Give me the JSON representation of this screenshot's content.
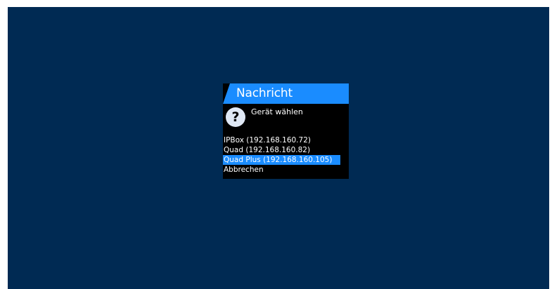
{
  "dialog": {
    "title": "Nachricht",
    "icon": "question-mark-icon",
    "message": "Gerät wählen",
    "options": [
      {
        "label": "IPBox (192.168.160.72)",
        "selected": false
      },
      {
        "label": "Quad (192.168.160.82)",
        "selected": false
      },
      {
        "label": "Quad Plus (192.168.160.105)",
        "selected": true
      },
      {
        "label": "Abbrechen",
        "selected": false
      }
    ]
  },
  "colors": {
    "background": "#002a53",
    "accent": "#1a8cff",
    "dialog_bg": "#000000"
  }
}
